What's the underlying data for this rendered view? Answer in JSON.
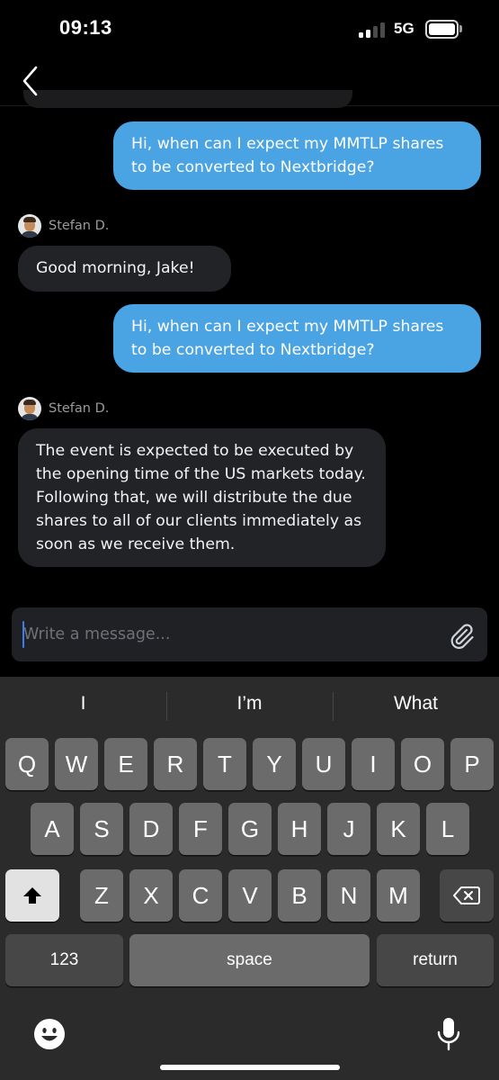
{
  "status_bar": {
    "time": "09:13",
    "network": "5G",
    "signal_bars": 2,
    "battery_level": 1.0
  },
  "chat": {
    "messages": [
      {
        "direction": "outgoing",
        "text": "Hi, when can I expect my MMTLP shares to be converted to Nextbridge?"
      },
      {
        "direction": "incoming",
        "sender": "Stefan D.",
        "text": "Good morning, Jake!"
      },
      {
        "direction": "outgoing",
        "text": "Hi, when can I expect my MMTLP shares to be converted to Nextbridge?"
      },
      {
        "direction": "incoming",
        "sender": "Stefan D.",
        "text": "The event is expected to be executed by the opening time of the US markets today. Following that, we will distribute the due shares to all of our clients immediately as soon as we receive them."
      }
    ]
  },
  "composer": {
    "placeholder": "Write a message...",
    "value": ""
  },
  "keyboard": {
    "suggestions": [
      "I",
      "I’m",
      "What"
    ],
    "row1": [
      "Q",
      "W",
      "E",
      "R",
      "T",
      "Y",
      "U",
      "I",
      "O",
      "P"
    ],
    "row2": [
      "A",
      "S",
      "D",
      "F",
      "G",
      "H",
      "J",
      "K",
      "L"
    ],
    "row3": [
      "Z",
      "X",
      "C",
      "V",
      "B",
      "N",
      "M"
    ],
    "numbers_label": "123",
    "space_label": "space",
    "return_label": "return"
  },
  "colors": {
    "outgoing_bubble": "#4aa3e3",
    "incoming_bubble": "#222326",
    "caret": "#3b7cf0"
  },
  "icons": [
    "back-chevron-icon",
    "paperclip-icon",
    "shift-icon",
    "delete-icon",
    "emoji-icon",
    "microphone-icon"
  ]
}
